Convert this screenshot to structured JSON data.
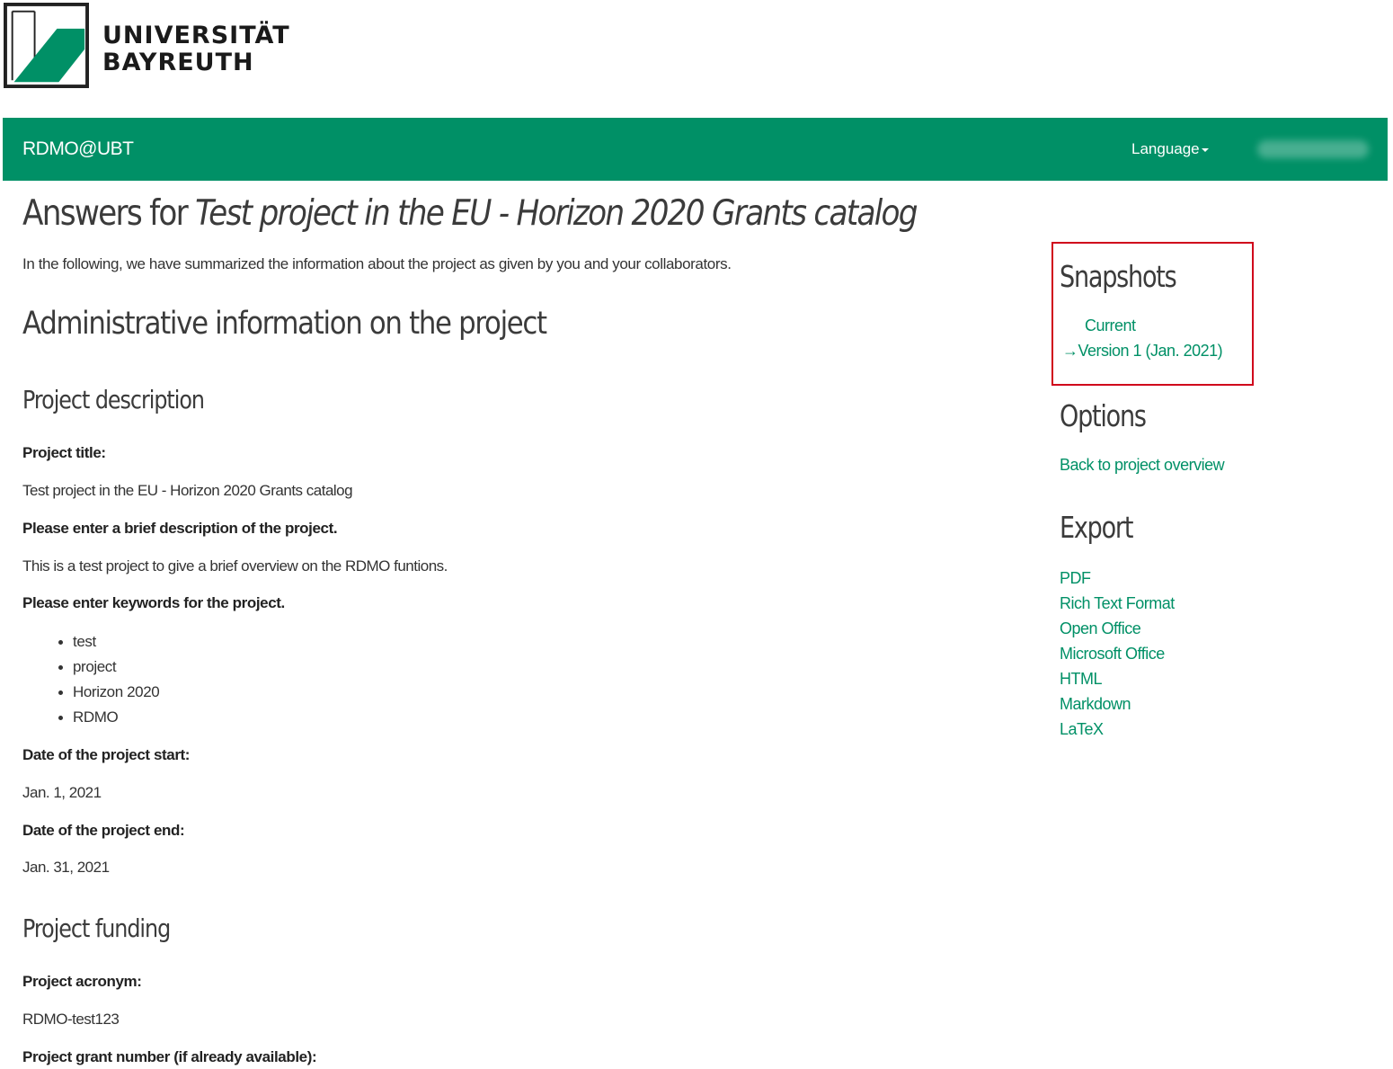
{
  "logo": {
    "line1": "UNIVERSITÄT",
    "line2": "BAYREUTH",
    "brand_color": "#009066"
  },
  "navbar": {
    "brand": "RDMO@UBT",
    "language_label": "Language",
    "background": "#009066"
  },
  "main": {
    "title_prefix": "Answers for ",
    "title_project": "Test project in the EU - Horizon 2020 Grants catalog",
    "intro": "In the following, we have summarized the information about the project as given by you and your collaborators.",
    "section_title": "Administrative information on the project",
    "subsections": {
      "description": {
        "title": "Project description",
        "q_title": "Project title:",
        "a_title": "Test project in the EU - Horizon 2020 Grants catalog",
        "q_brief": "Please enter a brief description of the project.",
        "a_brief": "This is a test project to give a brief overview on the RDMO funtions.",
        "q_keywords": "Please enter keywords for the project.",
        "keywords": [
          "test",
          "project",
          "Horizon 2020",
          "RDMO"
        ],
        "q_start": "Date of the project start:",
        "a_start": "Jan. 1, 2021",
        "q_end": "Date of the project end:",
        "a_end": "Jan. 31, 2021"
      },
      "funding": {
        "title": "Project funding",
        "q_acronym": "Project acronym:",
        "a_acronym": "RDMO-test123",
        "q_grant": "Project grant number (if already available):"
      }
    }
  },
  "sidebar": {
    "snapshots": {
      "title": "Snapshots",
      "current": "Current",
      "arrow": "→",
      "version": "Version 1 (Jan. 2021)",
      "highlight_color": "#d0021b"
    },
    "options": {
      "title": "Options",
      "back": "Back to project overview"
    },
    "export": {
      "title": "Export",
      "formats": [
        "PDF",
        "Rich Text Format",
        "Open Office",
        "Microsoft Office",
        "HTML",
        "Markdown",
        "LaTeX"
      ]
    },
    "link_color": "#009066"
  }
}
